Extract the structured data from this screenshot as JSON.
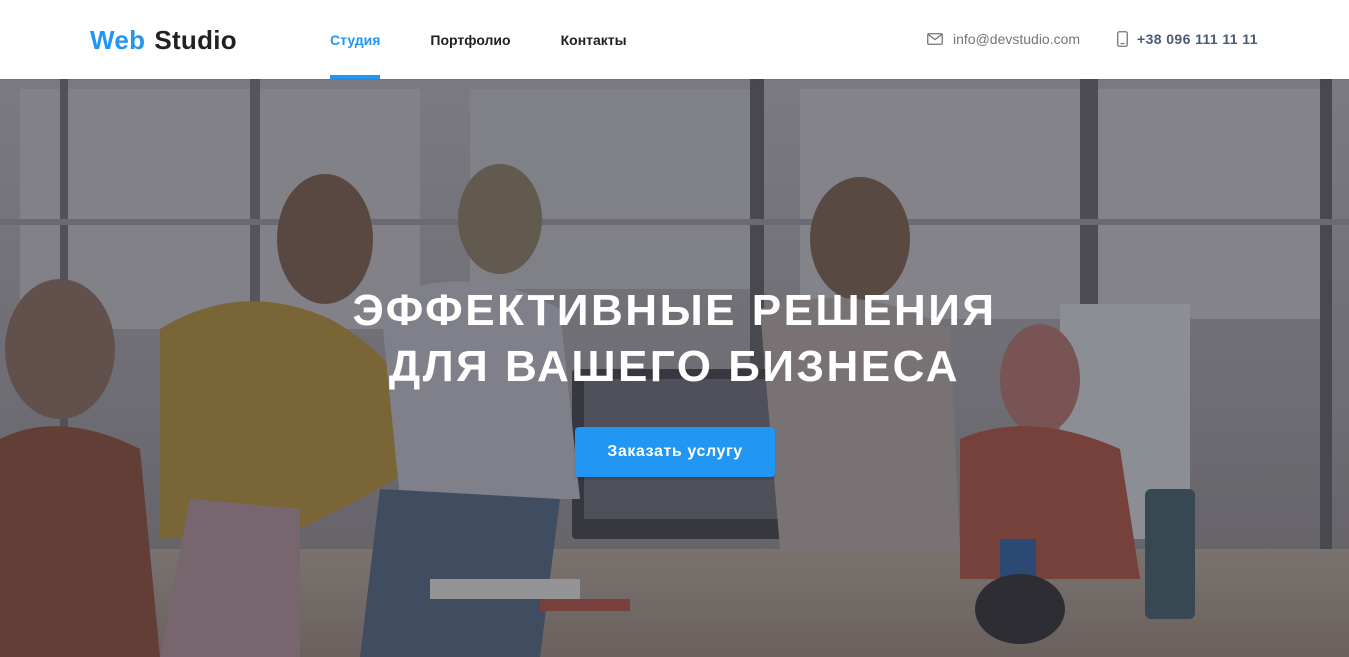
{
  "header": {
    "logo": {
      "accent": "Web",
      "main": "Studio"
    },
    "nav": [
      {
        "label": "Студия",
        "active": true
      },
      {
        "label": "Портфолио",
        "active": false
      },
      {
        "label": "Контакты",
        "active": false
      }
    ],
    "contacts": {
      "email": {
        "icon": "mail-icon",
        "text": "info@devstudio.com"
      },
      "phone": {
        "icon": "phone-icon",
        "text": "+38 096 111 11 11"
      }
    }
  },
  "hero": {
    "title_line1": "Эффективные решения",
    "title_line2": "для вашего бизнеса",
    "cta_label": "Заказать услугу",
    "background": "office-team-photo"
  },
  "colors": {
    "accent": "#2196f3",
    "text": "#212121",
    "muted": "#757575",
    "phone": "#4b5a73"
  }
}
